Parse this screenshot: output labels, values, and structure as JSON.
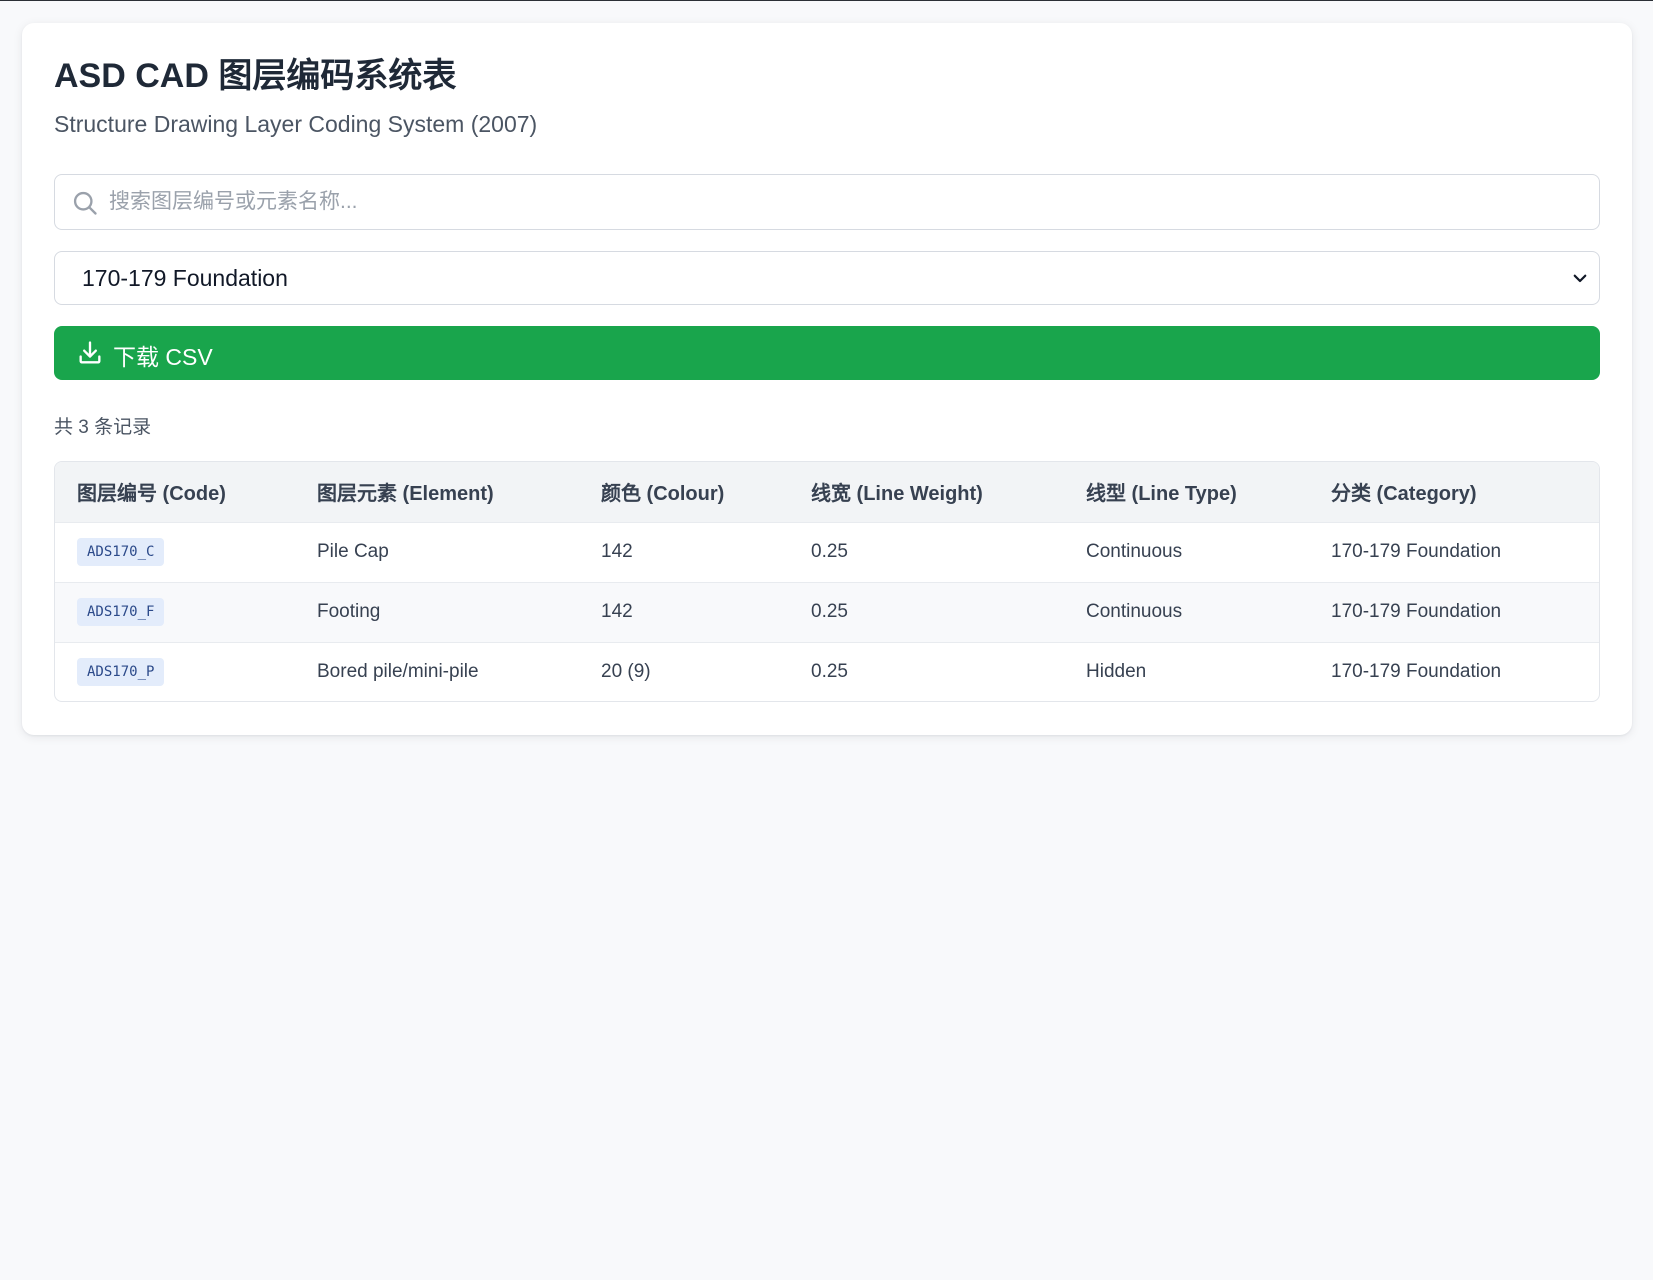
{
  "header": {
    "title": "ASD CAD 图层编码系统表",
    "subtitle": "Structure Drawing Layer Coding System (2007)"
  },
  "search": {
    "placeholder": "搜索图层编号或元素名称...",
    "icon": "search-icon"
  },
  "filter": {
    "selected": "170-179 Foundation",
    "icon": "chevron-down-icon"
  },
  "download": {
    "label": "下载 CSV",
    "icon": "download-icon",
    "color": "#19a54c"
  },
  "summary": {
    "count_text": "共 3 条记录"
  },
  "table": {
    "headers": [
      "图层编号 (Code)",
      "图层元素 (Element)",
      "颜色 (Colour)",
      "线宽 (Line Weight)",
      "线型 (Line Type)",
      "分类 (Category)"
    ],
    "rows": [
      {
        "code": "ADS170_C",
        "element": "Pile Cap",
        "colour": "142",
        "line_weight": "0.25",
        "line_type": "Continuous",
        "category": "170-179 Foundation"
      },
      {
        "code": "ADS170_F",
        "element": "Footing",
        "colour": "142",
        "line_weight": "0.25",
        "line_type": "Continuous",
        "category": "170-179 Foundation"
      },
      {
        "code": "ADS170_P",
        "element": "Bored pile/mini-pile",
        "colour": "20 (9)",
        "line_weight": "0.25",
        "line_type": "Hidden",
        "category": "170-179 Foundation"
      }
    ]
  }
}
